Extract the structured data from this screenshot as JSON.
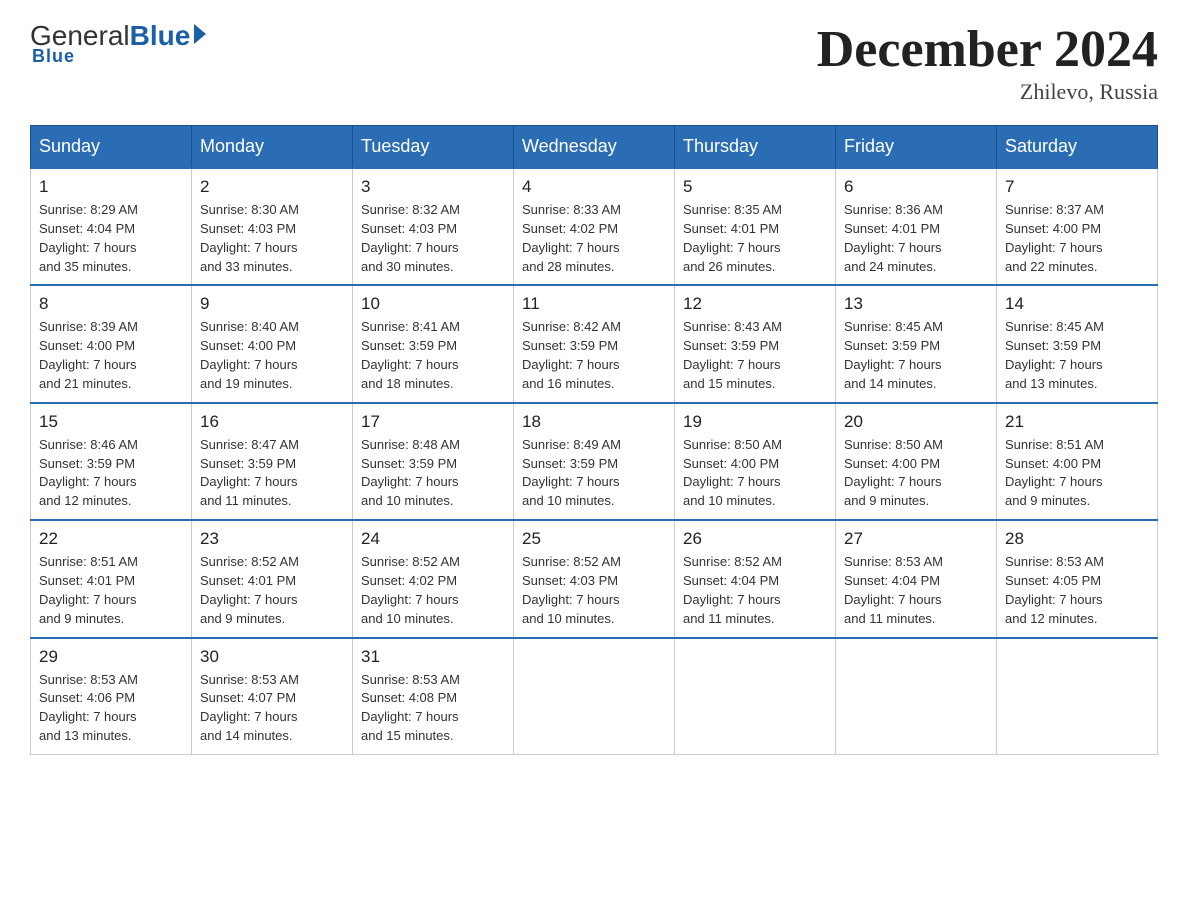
{
  "header": {
    "logo_general": "General",
    "logo_blue": "Blue",
    "month_title": "December 2024",
    "location": "Zhilevo, Russia"
  },
  "days_of_week": [
    "Sunday",
    "Monday",
    "Tuesday",
    "Wednesday",
    "Thursday",
    "Friday",
    "Saturday"
  ],
  "weeks": [
    [
      {
        "num": "1",
        "info": "Sunrise: 8:29 AM\nSunset: 4:04 PM\nDaylight: 7 hours\nand 35 minutes."
      },
      {
        "num": "2",
        "info": "Sunrise: 8:30 AM\nSunset: 4:03 PM\nDaylight: 7 hours\nand 33 minutes."
      },
      {
        "num": "3",
        "info": "Sunrise: 8:32 AM\nSunset: 4:03 PM\nDaylight: 7 hours\nand 30 minutes."
      },
      {
        "num": "4",
        "info": "Sunrise: 8:33 AM\nSunset: 4:02 PM\nDaylight: 7 hours\nand 28 minutes."
      },
      {
        "num": "5",
        "info": "Sunrise: 8:35 AM\nSunset: 4:01 PM\nDaylight: 7 hours\nand 26 minutes."
      },
      {
        "num": "6",
        "info": "Sunrise: 8:36 AM\nSunset: 4:01 PM\nDaylight: 7 hours\nand 24 minutes."
      },
      {
        "num": "7",
        "info": "Sunrise: 8:37 AM\nSunset: 4:00 PM\nDaylight: 7 hours\nand 22 minutes."
      }
    ],
    [
      {
        "num": "8",
        "info": "Sunrise: 8:39 AM\nSunset: 4:00 PM\nDaylight: 7 hours\nand 21 minutes."
      },
      {
        "num": "9",
        "info": "Sunrise: 8:40 AM\nSunset: 4:00 PM\nDaylight: 7 hours\nand 19 minutes."
      },
      {
        "num": "10",
        "info": "Sunrise: 8:41 AM\nSunset: 3:59 PM\nDaylight: 7 hours\nand 18 minutes."
      },
      {
        "num": "11",
        "info": "Sunrise: 8:42 AM\nSunset: 3:59 PM\nDaylight: 7 hours\nand 16 minutes."
      },
      {
        "num": "12",
        "info": "Sunrise: 8:43 AM\nSunset: 3:59 PM\nDaylight: 7 hours\nand 15 minutes."
      },
      {
        "num": "13",
        "info": "Sunrise: 8:45 AM\nSunset: 3:59 PM\nDaylight: 7 hours\nand 14 minutes."
      },
      {
        "num": "14",
        "info": "Sunrise: 8:45 AM\nSunset: 3:59 PM\nDaylight: 7 hours\nand 13 minutes."
      }
    ],
    [
      {
        "num": "15",
        "info": "Sunrise: 8:46 AM\nSunset: 3:59 PM\nDaylight: 7 hours\nand 12 minutes."
      },
      {
        "num": "16",
        "info": "Sunrise: 8:47 AM\nSunset: 3:59 PM\nDaylight: 7 hours\nand 11 minutes."
      },
      {
        "num": "17",
        "info": "Sunrise: 8:48 AM\nSunset: 3:59 PM\nDaylight: 7 hours\nand 10 minutes."
      },
      {
        "num": "18",
        "info": "Sunrise: 8:49 AM\nSunset: 3:59 PM\nDaylight: 7 hours\nand 10 minutes."
      },
      {
        "num": "19",
        "info": "Sunrise: 8:50 AM\nSunset: 4:00 PM\nDaylight: 7 hours\nand 10 minutes."
      },
      {
        "num": "20",
        "info": "Sunrise: 8:50 AM\nSunset: 4:00 PM\nDaylight: 7 hours\nand 9 minutes."
      },
      {
        "num": "21",
        "info": "Sunrise: 8:51 AM\nSunset: 4:00 PM\nDaylight: 7 hours\nand 9 minutes."
      }
    ],
    [
      {
        "num": "22",
        "info": "Sunrise: 8:51 AM\nSunset: 4:01 PM\nDaylight: 7 hours\nand 9 minutes."
      },
      {
        "num": "23",
        "info": "Sunrise: 8:52 AM\nSunset: 4:01 PM\nDaylight: 7 hours\nand 9 minutes."
      },
      {
        "num": "24",
        "info": "Sunrise: 8:52 AM\nSunset: 4:02 PM\nDaylight: 7 hours\nand 10 minutes."
      },
      {
        "num": "25",
        "info": "Sunrise: 8:52 AM\nSunset: 4:03 PM\nDaylight: 7 hours\nand 10 minutes."
      },
      {
        "num": "26",
        "info": "Sunrise: 8:52 AM\nSunset: 4:04 PM\nDaylight: 7 hours\nand 11 minutes."
      },
      {
        "num": "27",
        "info": "Sunrise: 8:53 AM\nSunset: 4:04 PM\nDaylight: 7 hours\nand 11 minutes."
      },
      {
        "num": "28",
        "info": "Sunrise: 8:53 AM\nSunset: 4:05 PM\nDaylight: 7 hours\nand 12 minutes."
      }
    ],
    [
      {
        "num": "29",
        "info": "Sunrise: 8:53 AM\nSunset: 4:06 PM\nDaylight: 7 hours\nand 13 minutes."
      },
      {
        "num": "30",
        "info": "Sunrise: 8:53 AM\nSunset: 4:07 PM\nDaylight: 7 hours\nand 14 minutes."
      },
      {
        "num": "31",
        "info": "Sunrise: 8:53 AM\nSunset: 4:08 PM\nDaylight: 7 hours\nand 15 minutes."
      },
      null,
      null,
      null,
      null
    ]
  ]
}
